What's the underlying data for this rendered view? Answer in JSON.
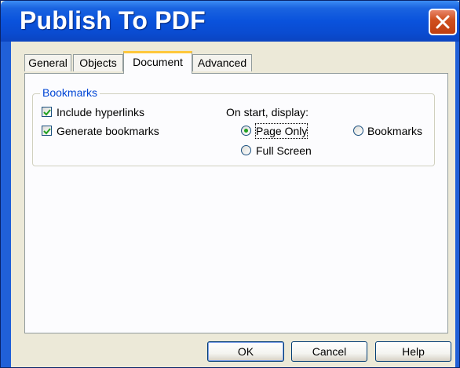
{
  "window": {
    "title": "Publish To PDF",
    "title_color": "#ffffff",
    "titlebar_color": "#0a52dc",
    "close_icon": "close-icon"
  },
  "tabs": [
    {
      "label": "General",
      "active": false
    },
    {
      "label": "Objects",
      "active": false
    },
    {
      "label": "Document",
      "active": true
    },
    {
      "label": "Advanced",
      "active": false
    }
  ],
  "bookmarks_group": {
    "label": "Bookmarks",
    "include_hyperlinks": {
      "label": "Include hyperlinks",
      "checked": true
    },
    "generate_bookmarks": {
      "label": "Generate bookmarks",
      "checked": true
    },
    "on_start_label": "On start, display:",
    "display_options": [
      {
        "label": "Page Only",
        "selected": true
      },
      {
        "label": "Bookmarks",
        "selected": false
      },
      {
        "label": "Full Screen",
        "selected": false
      }
    ]
  },
  "buttons": {
    "ok": "OK",
    "cancel": "Cancel",
    "help": "Help"
  }
}
